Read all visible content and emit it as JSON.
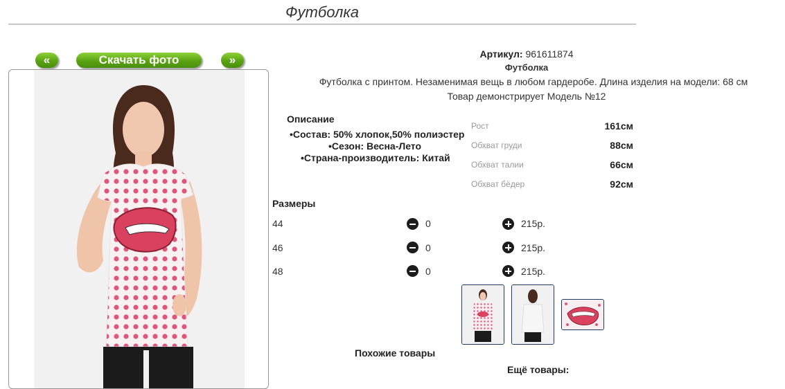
{
  "page": {
    "title": "Футболка"
  },
  "gallery": {
    "prev_label": "«",
    "download_label": "Скачать фото",
    "next_label": "»"
  },
  "product": {
    "article_label": "Артикул:",
    "article_value": "961611874",
    "name": "Футболка",
    "description": "Футболка с принтом. Незаменимая вещь в любом гардеробе. Длина изделия на модели: 68 см",
    "model_line": "Товар демонстрирует Модель №12"
  },
  "details": {
    "title": "Описание",
    "items": [
      "Состав: 50% хлопок,50% полиэстер",
      "Сезон: Весна-Лето",
      "Страна-производитель: Китай"
    ]
  },
  "measurements": [
    {
      "label": "Рост",
      "value": "161см"
    },
    {
      "label": "Обхват груди",
      "value": "88см"
    },
    {
      "label": "Обхват талии",
      "value": "66см"
    },
    {
      "label": "Обхват бёдер",
      "value": "92см"
    }
  ],
  "sizes": {
    "title": "Размеры",
    "rows": [
      {
        "size": "44",
        "qty": "0",
        "price": "215р."
      },
      {
        "size": "46",
        "qty": "0",
        "price": "215р."
      },
      {
        "size": "48",
        "qty": "0",
        "price": "215р."
      }
    ]
  },
  "footer": {
    "similar": "Похожие товары",
    "more": "Ещё товары:"
  },
  "colors": {
    "accent_green": "#5aa312",
    "dots_pink": "#e0557a",
    "thumb_border": "#1f3a5f"
  }
}
